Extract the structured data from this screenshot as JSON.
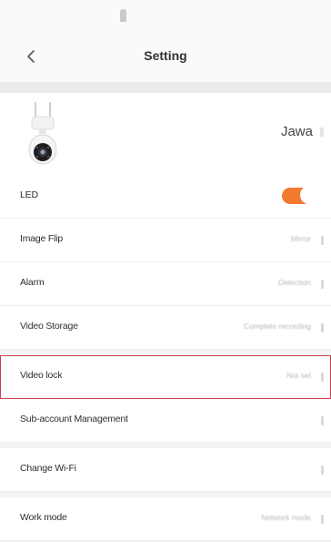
{
  "header": {
    "title": "Setting"
  },
  "device": {
    "name": "Jawa"
  },
  "settings": {
    "led": {
      "label": "LED",
      "enabled": true
    },
    "items": [
      {
        "label": "Image Flip",
        "value": "Mirror"
      },
      {
        "label": "Alarm",
        "value": "Detection"
      },
      {
        "label": "Video Storage",
        "value": "Complete recording"
      },
      {
        "label": "Video lock",
        "value": "Not set"
      },
      {
        "label": "Sub-account Management",
        "value": ""
      },
      {
        "label": "Change Wi-Fi",
        "value": ""
      },
      {
        "label": "Work mode",
        "value": "Network mode"
      }
    ]
  },
  "colors": {
    "accent": "#f07a30",
    "highlight_border": "#c8434f"
  }
}
